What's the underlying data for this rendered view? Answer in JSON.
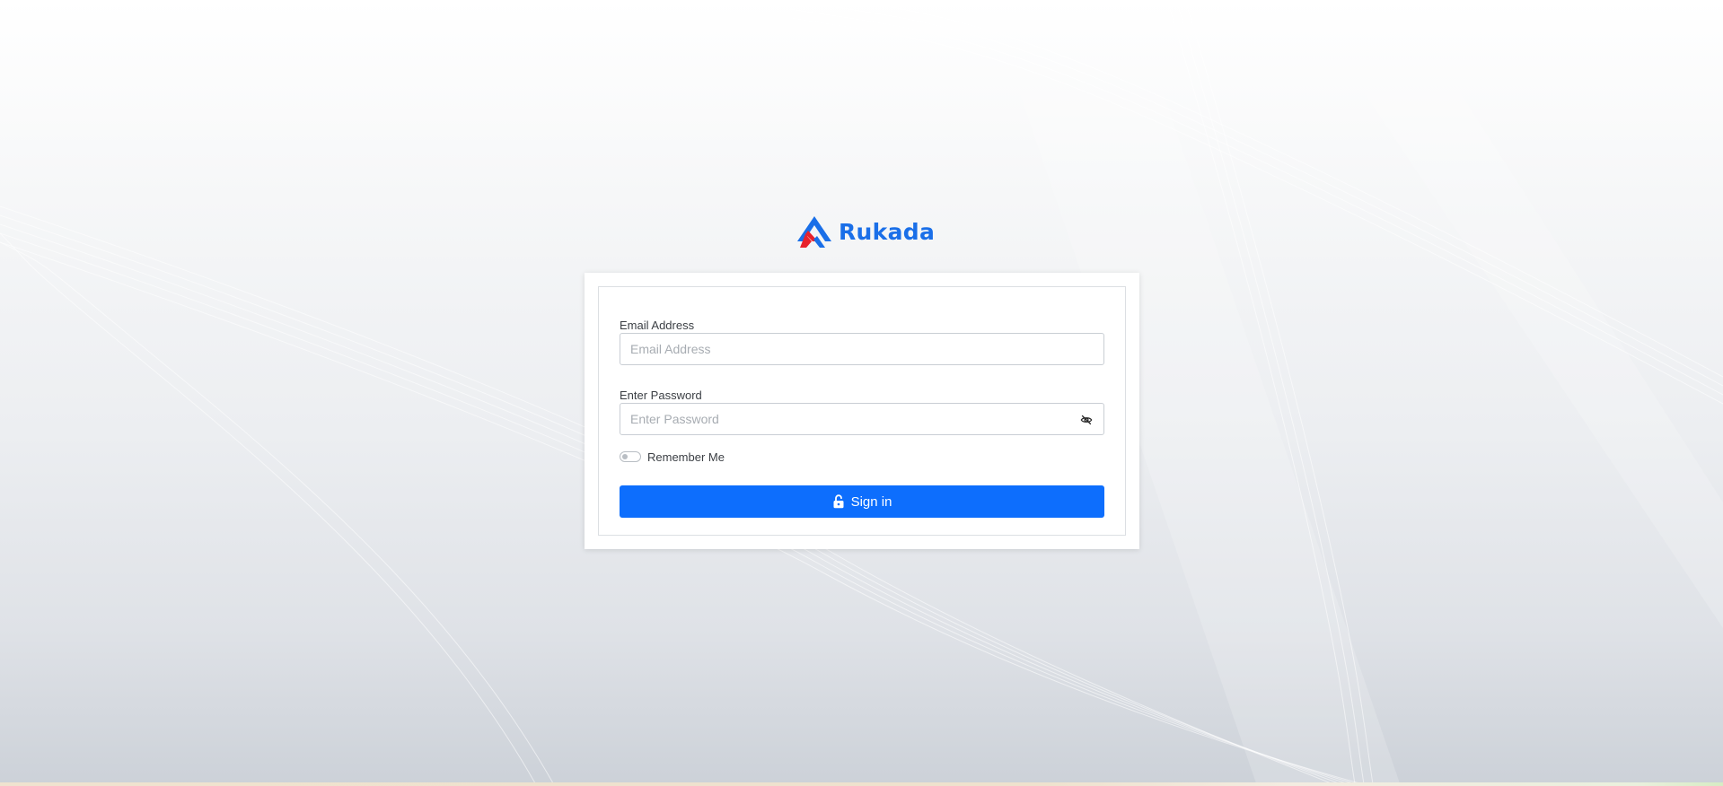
{
  "brand": {
    "name": "Rukada",
    "color": "#1a6fe8",
    "logo_icon": "rukada-logo-icon",
    "logo_colors": [
      "#1a6fe8",
      "#e8222b"
    ]
  },
  "form": {
    "email_label": "Email Address",
    "email_placeholder": "Email Address",
    "email_value": "",
    "password_label": "Enter Password",
    "password_placeholder": "Enter Password",
    "password_value": "",
    "password_toggle_icon": "eye-slash-icon",
    "remember_label": "Remember Me",
    "remember_checked": false,
    "submit_label": "Sign in",
    "submit_icon": "unlock-icon",
    "submit_color": "#0d6efd"
  }
}
